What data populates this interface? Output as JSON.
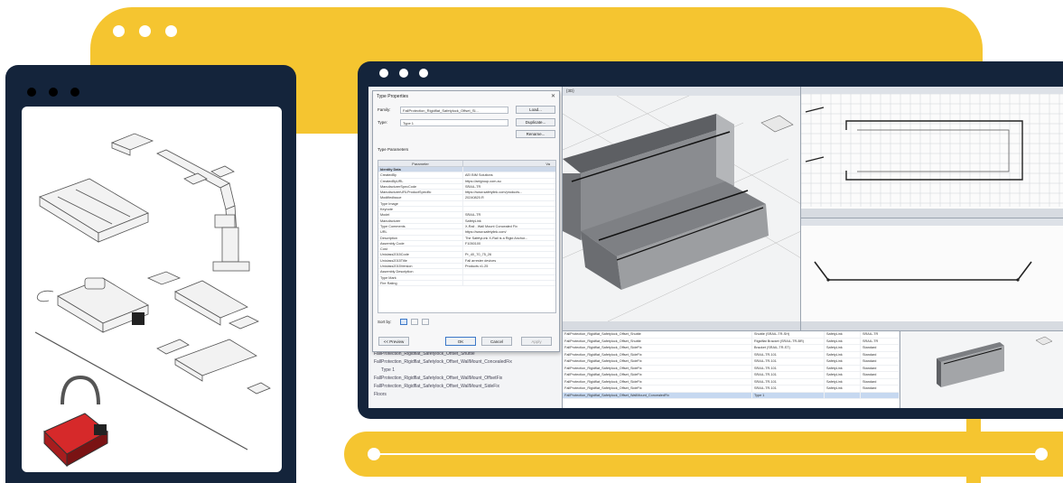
{
  "colors": {
    "accent_yellow": "#f5c530",
    "navy": "#14243b",
    "selection_blue": "#c6d8f0"
  },
  "dialog": {
    "title": "Type Properties",
    "family_label": "Family:",
    "family_value": "FallProtection_Rigidflat_Safetylock_Offset_Sl...",
    "type_label": "Type:",
    "type_value": "Type 1",
    "load_button": "Load...",
    "duplicate_button": "Duplicate...",
    "rename_button": "Rename...",
    "type_parameters_label": "Type Parameters",
    "col_parameter": "Parameter",
    "col_value": "Va",
    "rows": [
      {
        "p": "Identity Data",
        "v": "",
        "group": true
      },
      {
        "p": "CreatedBy",
        "v": "AEI BIM Solutions"
      },
      {
        "p": "CreatedByURL",
        "v": "https://aeigroup.com.au"
      },
      {
        "p": "ManufacturerSpecCode",
        "v": "SRAIL-TR"
      },
      {
        "p": "ManufacturerURLProductSpecific",
        "v": "https://www.safetylink.com/products..."
      },
      {
        "p": "ModifiedIssue",
        "v": "20240820.R"
      },
      {
        "p": "Type Image",
        "v": ""
      },
      {
        "p": "Keynote",
        "v": ""
      },
      {
        "p": "Model",
        "v": "SRAIL-TR"
      },
      {
        "p": "Manufacturer",
        "v": "SafetyLink"
      },
      {
        "p": "Type Comments",
        "v": "X-Rail - Wall Mount Concealed Fix"
      },
      {
        "p": "URL",
        "v": "https://www.safetylink.com/"
      },
      {
        "p": "Description",
        "v": "The SafetyLink X-Rail is a Rigid Anchor..."
      },
      {
        "p": "Assembly Code",
        "v": "F1050100"
      },
      {
        "p": "Cost",
        "v": ""
      },
      {
        "p": "Uniclass2015Code",
        "v": "Pr_40_70_75_26"
      },
      {
        "p": "Uniclass2015Title",
        "v": "Fall arrester devices"
      },
      {
        "p": "Uniclass2015Version",
        "v": "Products v1.25"
      },
      {
        "p": "Assembly Description",
        "v": ""
      },
      {
        "p": "Type Mark",
        "v": ""
      },
      {
        "p": "Fire Rating",
        "v": ""
      }
    ],
    "preview_label": "<< Preview",
    "ok_button": "OK",
    "cancel_button": "Cancel",
    "apply_button": "Apply",
    "set_label": "Sort by:"
  },
  "browser_items": [
    "FallProtection_Rigidflat_Safetylock_Offset_Shuttle",
    "FallProtection_Rigidflat_Safetylock_Offset_WallMount_ConcealedFix",
    "Type 1",
    "FallProtection_Rigidflat_Safetylock_Offset_WallMount_OffsetFix",
    "FallProtection_Rigidflat_Safetylock_Offset_WallMount_SideFix",
    "Floors"
  ],
  "view3d_tab": "{3D}",
  "schedule_rows": [
    {
      "a": "FallProtection_Rigidflat_Safetylock_Offset_Shuttle",
      "b": "Shuttle (SRAIL-TR-SH)",
      "c": "SafetyLink",
      "d": "SRAIL-TR"
    },
    {
      "a": "FallProtection_Rigidflat_Safetylock_Offset_Shuttle",
      "b": "Rigidflat Bracket (SRAIL-TR-BR)",
      "c": "SafetyLink",
      "d": "SRAIL-TR"
    },
    {
      "a": "FallProtection_Rigidflat_Safetylock_Offset_SideFix",
      "b": "Bracket (SRAIL-TR-ST)",
      "c": "SafetyLink",
      "d": "Standard"
    },
    {
      "a": "FallProtection_Rigidflat_Safetylock_Offset_SideFix",
      "b": "SRAIL-TR-101",
      "c": "SafetyLink",
      "d": "Standard"
    },
    {
      "a": "FallProtection_Rigidflat_Safetylock_Offset_SideFix",
      "b": "SRAIL-TR-101",
      "c": "SafetyLink",
      "d": "Standard"
    },
    {
      "a": "FallProtection_Rigidflat_Safetylock_Offset_SideFix",
      "b": "SRAIL-TR-101",
      "c": "SafetyLink",
      "d": "Standard"
    },
    {
      "a": "FallProtection_Rigidflat_Safetylock_Offset_SideFix",
      "b": "SRAIL-TR-101",
      "c": "SafetyLink",
      "d": "Standard"
    },
    {
      "a": "FallProtection_Rigidflat_Safetylock_Offset_SideFix",
      "b": "SRAIL-TR-101",
      "c": "SafetyLink",
      "d": "Standard"
    },
    {
      "a": "FallProtection_Rigidflat_Safetylock_Offset_SideFix",
      "b": "SRAIL-TR-101",
      "c": "SafetyLink",
      "d": "Standard"
    },
    {
      "a": "FallProtection_Rigidflat_Safetylock_Offset_WallMount_ConcealedFix",
      "b": "Type 1",
      "c": "",
      "d": "",
      "selected": true
    }
  ]
}
